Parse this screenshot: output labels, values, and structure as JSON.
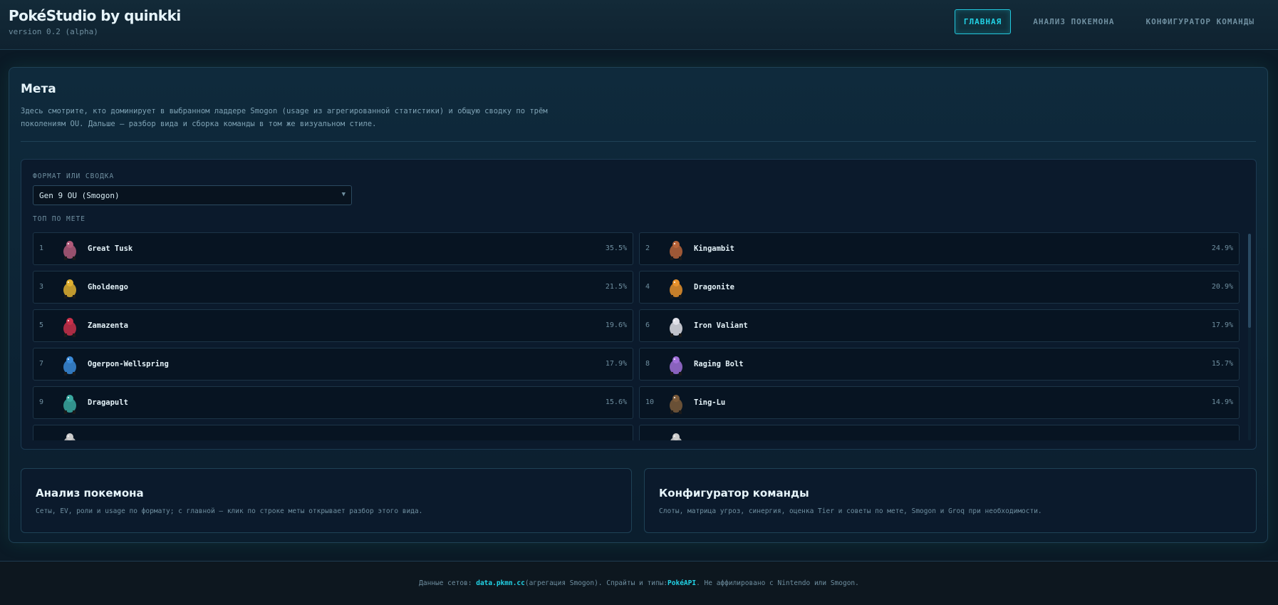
{
  "app": {
    "title": "PokéStudio by quinkki",
    "version": "version 0.2 (alpha)"
  },
  "nav": [
    {
      "label": "ГЛАВНАЯ",
      "active": true
    },
    {
      "label": "АНАЛИЗ ПОКЕМОНА",
      "active": false
    },
    {
      "label": "КОНФИГУРАТОР КОМАНДЫ",
      "active": false
    }
  ],
  "meta": {
    "title": "Мета",
    "description": "Здесь смотрите, кто доминирует в выбранном ладдере Smogon (usage из агрегированной статистики) и общую сводку по трём поколениям OU. Дальше — разбор вида и сборка команды в том же визуальном стиле.",
    "format_label": "ФОРМАТ ИЛИ СВОДКА",
    "format_value": "Gen 9 OU (Smogon)",
    "top_label": "ТОП ПО МЕТЕ"
  },
  "top_list": [
    {
      "rank": "1",
      "name": "Great Tusk",
      "usage": "35.5%",
      "color": "#b05a7a"
    },
    {
      "rank": "2",
      "name": "Kingambit",
      "usage": "24.9%",
      "color": "#b8643a"
    },
    {
      "rank": "3",
      "name": "Gholdengo",
      "usage": "21.5%",
      "color": "#e0b030"
    },
    {
      "rank": "4",
      "name": "Dragonite",
      "usage": "20.9%",
      "color": "#e8922c"
    },
    {
      "rank": "5",
      "name": "Zamazenta",
      "usage": "19.6%",
      "color": "#c8304a"
    },
    {
      "rank": "6",
      "name": "Iron Valiant",
      "usage": "17.9%",
      "color": "#e0e0e8"
    },
    {
      "rank": "7",
      "name": "Ogerpon-Wellspring",
      "usage": "17.9%",
      "color": "#3a8ad8"
    },
    {
      "rank": "8",
      "name": "Raging Bolt",
      "usage": "15.7%",
      "color": "#a070d8"
    },
    {
      "rank": "9",
      "name": "Dragapult",
      "usage": "15.6%",
      "color": "#3aa8a0"
    },
    {
      "rank": "10",
      "name": "Ting-Lu",
      "usage": "14.9%",
      "color": "#7a5a3a"
    },
    {
      "rank": "",
      "name": "",
      "usage": "",
      "color": "#cccccc"
    },
    {
      "rank": "",
      "name": "",
      "usage": "",
      "color": "#cccccc"
    }
  ],
  "cards": [
    {
      "title": "Анализ покемона",
      "desc": "Сеты, EV, роли и usage по формату; с главной — клик по строке меты открывает разбор этого вида."
    },
    {
      "title": "Конфигуратор команды",
      "desc": "Слоты, матрица угроз, синергия, оценка Tier и советы по мете, Smogon и Groq при необходимости."
    }
  ],
  "footer": {
    "prefix": "Данные сетов: ",
    "link1": "data.pkmn.cc",
    "mid": " (агрегация Smogon). Спрайты и типы: ",
    "link2": "PokéAPI",
    "suffix": ". Не аффилировано с Nintendo или Smogon."
  },
  "colors": {
    "accent": "#22d3e6",
    "background": "#0b1a26"
  }
}
